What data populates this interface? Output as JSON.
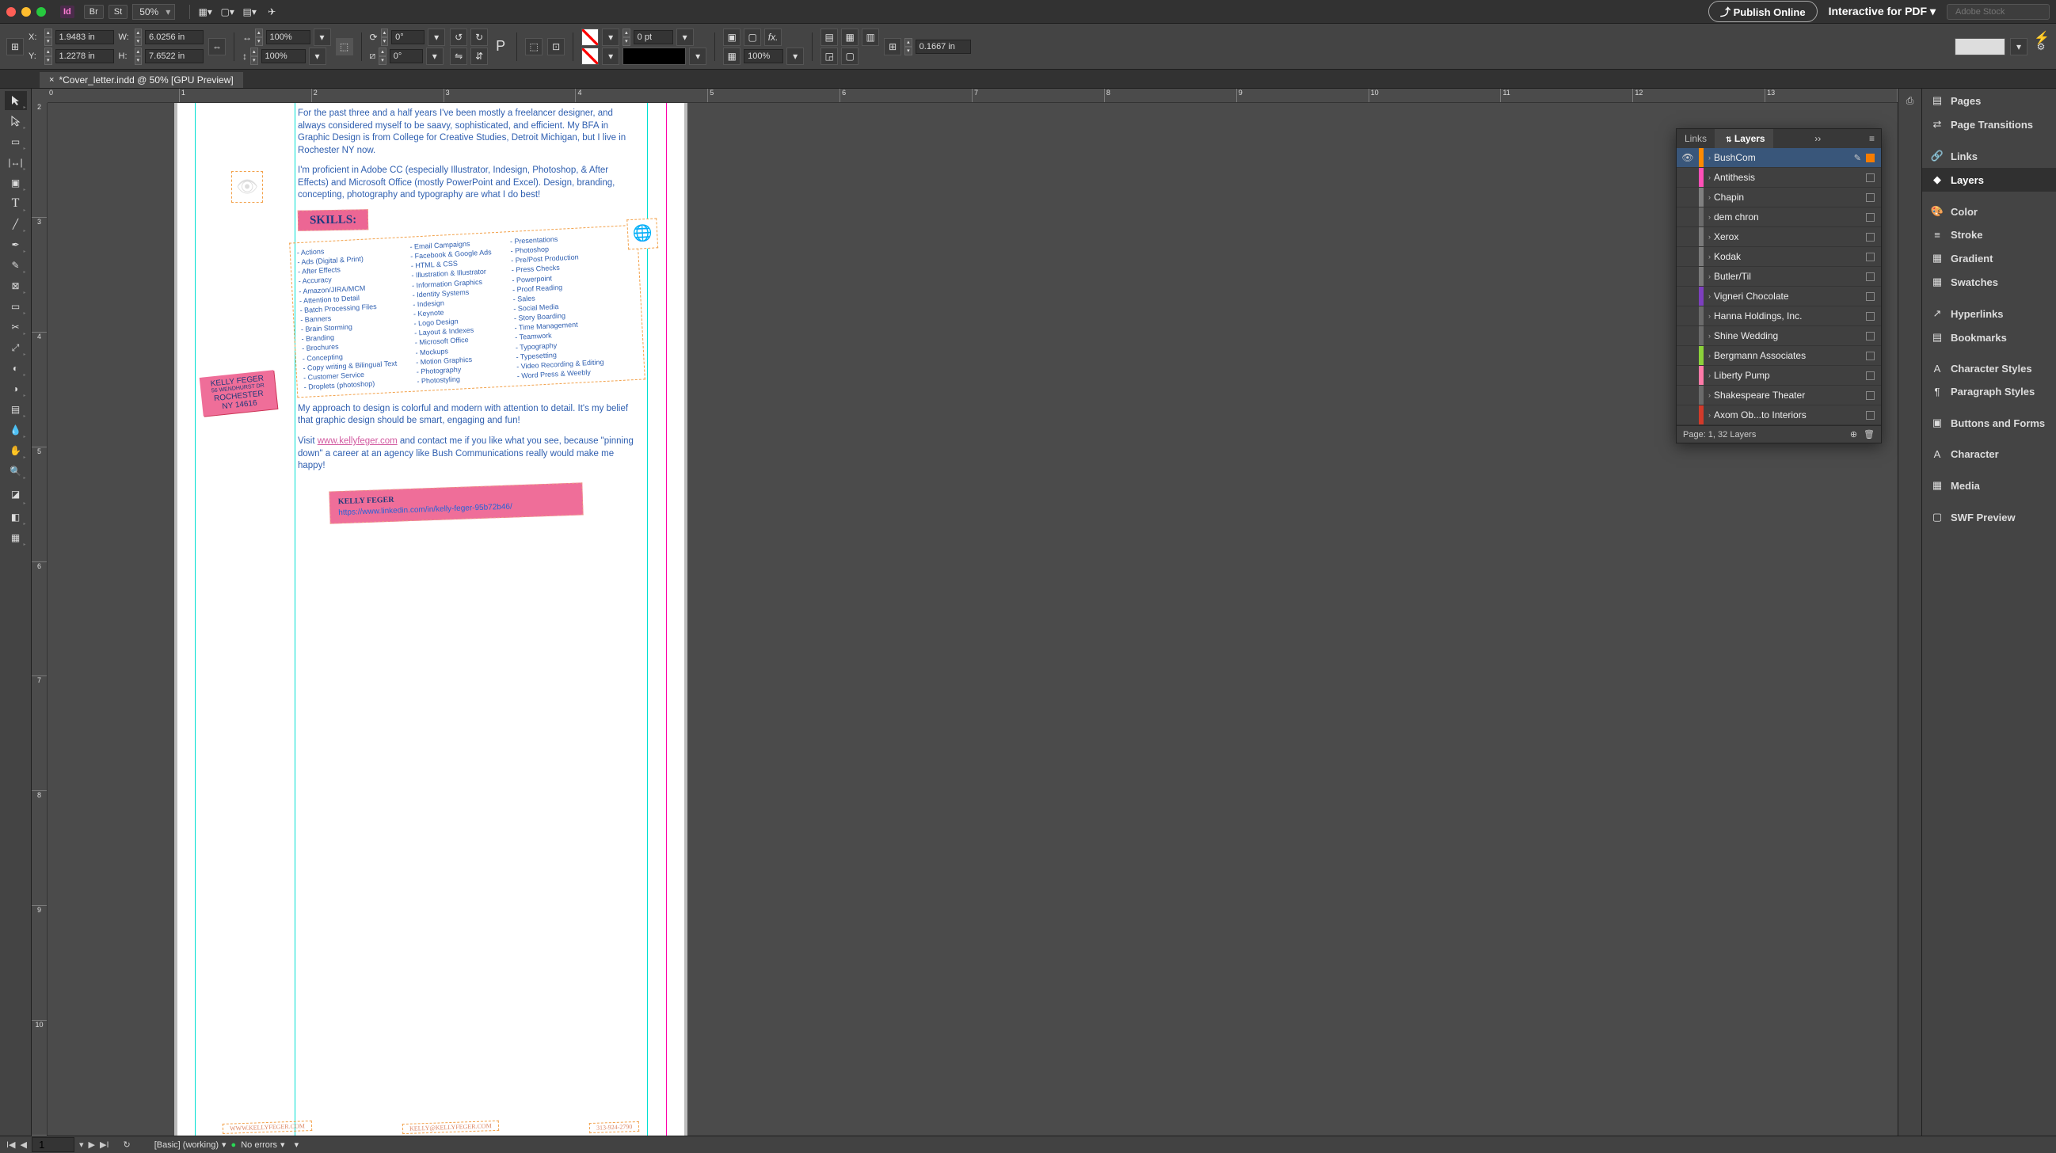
{
  "topbar": {
    "app_badge": "Id",
    "br_btn": "Br",
    "st_btn": "St",
    "zoom": "50%",
    "publish": "Publish Online",
    "workspace": "Interactive for PDF",
    "search_placeholder": "Adobe Stock"
  },
  "ctrl": {
    "x": "1.9483 in",
    "y": "1.2278 in",
    "w": "6.0256 in",
    "h": "7.6522 in",
    "scale_x": "100%",
    "scale_y": "100%",
    "rotate": "0°",
    "shear": "0°",
    "stroke_wt": "0 pt",
    "opacity": "100%",
    "gap": "0.1667 in"
  },
  "tab": {
    "title": "*Cover_letter.indd @ 50% [GPU Preview]"
  },
  "ruler_h": [
    "0",
    "1",
    "2",
    "3",
    "4",
    "5",
    "6",
    "7",
    "8",
    "9",
    "10",
    "11",
    "12",
    "13"
  ],
  "ruler_v": [
    "2",
    "3",
    "4",
    "5",
    "6",
    "7",
    "8",
    "9",
    "10"
  ],
  "doc": {
    "p1": "For the past three and a half years I've been mostly a freelancer designer, and always considered myself to be saavy, sophisticated, and efficient. My BFA in Graphic Design is from College for Creative Studies, Detroit Michigan, but I live in Rochester NY now.",
    "p2": "I'm proficient in Adobe CC (especially Illustrator, Indesign, Photoshop, & After Effects) and Microsoft Office (mostly PowerPoint and Excel). Design, branding, concepting, photography and typography are what I do best!",
    "skills_label": "SKILLS:",
    "skills_col1": [
      "Actions",
      "Ads (Digital & Print)",
      "After Effects",
      "Accuracy",
      "Amazon/JIRA/MCM",
      "Attention to Detail",
      "Batch Processing Files",
      "Banners",
      "Brain Storming",
      "Branding",
      "Brochures",
      "Concepting",
      "Copy writing & Bilingual Text",
      "Customer Service",
      "Droplets (photoshop)"
    ],
    "skills_col2": [
      "Email Campaigns",
      "Facebook & Google Ads",
      "HTML & CSS",
      "Illustration & Illustrator",
      "Information Graphics",
      "Identity Systems",
      "Indesign",
      "Keynote",
      "Logo Design",
      "Layout & Indexes",
      "Microsoft Office",
      "Mockups",
      "Motion Graphics",
      "Photography",
      "Photostyling"
    ],
    "skills_col3": [
      "Presentations",
      "Photoshop",
      "Pre/Post Production",
      "Press Checks",
      "Powerpoint",
      "Proof Reading",
      "Sales",
      "Social Media",
      "Story Boarding",
      "Time Management",
      "Teamwork",
      "Typography",
      "Typesetting",
      "Video Recording & Editing",
      "Word Press & Weebly"
    ],
    "p3": "My approach to design is colorful and modern with attention to detail. It's my belief that graphic design should be smart, engaging and fun!",
    "p4a": "Visit ",
    "p4link": "www.kellyfeger.com",
    "p4b": " and contact me if you like what you see, because \"pinning down\" a career at an agency like Bush Communications really would make me happy!",
    "linkedin_name": "KELLY FEGER",
    "linkedin_url": "https://www.linkedin.com/in/kelly-feger-95b72b46/",
    "address1": "KELLY FEGER",
    "address2": "56 WENDHURST DR",
    "address3": "ROCHESTER",
    "address4": "NY 14616",
    "foot1": "WWW.KELLYFEGER.COM",
    "foot2": "KELLY@KELLYFEGER.COM",
    "foot3": "313-924-2790"
  },
  "layers": {
    "tab_links": "Links",
    "tab_layers": "Layers",
    "items": [
      {
        "name": "BushCom",
        "color": "#ff8a00",
        "visible": true,
        "selected": true,
        "edit": true
      },
      {
        "name": "Antithesis",
        "color": "#ff4fb7"
      },
      {
        "name": "Chapin",
        "color": "#808080"
      },
      {
        "name": "dem chron",
        "color": "#6b6b6b"
      },
      {
        "name": "Xerox",
        "color": "#7a7a7a"
      },
      {
        "name": "Kodak",
        "color": "#7a7a7a"
      },
      {
        "name": "Butler/Til",
        "color": "#7a7a7a"
      },
      {
        "name": "Vigneri Chocolate",
        "color": "#7d3fbf"
      },
      {
        "name": "Hanna Holdings, Inc.",
        "color": "#6b6b6b"
      },
      {
        "name": "Shine Wedding",
        "color": "#6b6b6b"
      },
      {
        "name": "Bergmann Associates",
        "color": "#8bd13a"
      },
      {
        "name": "Liberty Pump",
        "color": "#ff7aa8"
      },
      {
        "name": "Shakespeare Theater",
        "color": "#6b6b6b"
      },
      {
        "name": "Axom Ob...to Interiors",
        "color": "#d23a2a"
      }
    ],
    "footer": "Page: 1, 32 Layers"
  },
  "rightdock": [
    {
      "icon": "▤",
      "label": "Pages"
    },
    {
      "icon": "⇄",
      "label": "Page Transitions"
    },
    {
      "sep": true
    },
    {
      "icon": "🔗",
      "label": "Links"
    },
    {
      "icon": "◆",
      "label": "Layers",
      "active": true
    },
    {
      "sep": true
    },
    {
      "icon": "🎨",
      "label": "Color"
    },
    {
      "icon": "≡",
      "label": "Stroke"
    },
    {
      "icon": "▦",
      "label": "Gradient"
    },
    {
      "icon": "▦",
      "label": "Swatches"
    },
    {
      "sep": true
    },
    {
      "icon": "↗",
      "label": "Hyperlinks"
    },
    {
      "icon": "▤",
      "label": "Bookmarks"
    },
    {
      "sep": true
    },
    {
      "icon": "A",
      "label": "Character Styles"
    },
    {
      "icon": "¶",
      "label": "Paragraph Styles"
    },
    {
      "sep": true
    },
    {
      "icon": "▣",
      "label": "Buttons and Forms"
    },
    {
      "sep": true
    },
    {
      "icon": "A",
      "label": "Character"
    },
    {
      "sep": true
    },
    {
      "icon": "▦",
      "label": "Media"
    },
    {
      "sep": true
    },
    {
      "icon": "▢",
      "label": "SWF Preview"
    }
  ],
  "bottom": {
    "page": "1",
    "preflight": "[Basic] (working)",
    "errors": "No errors"
  }
}
